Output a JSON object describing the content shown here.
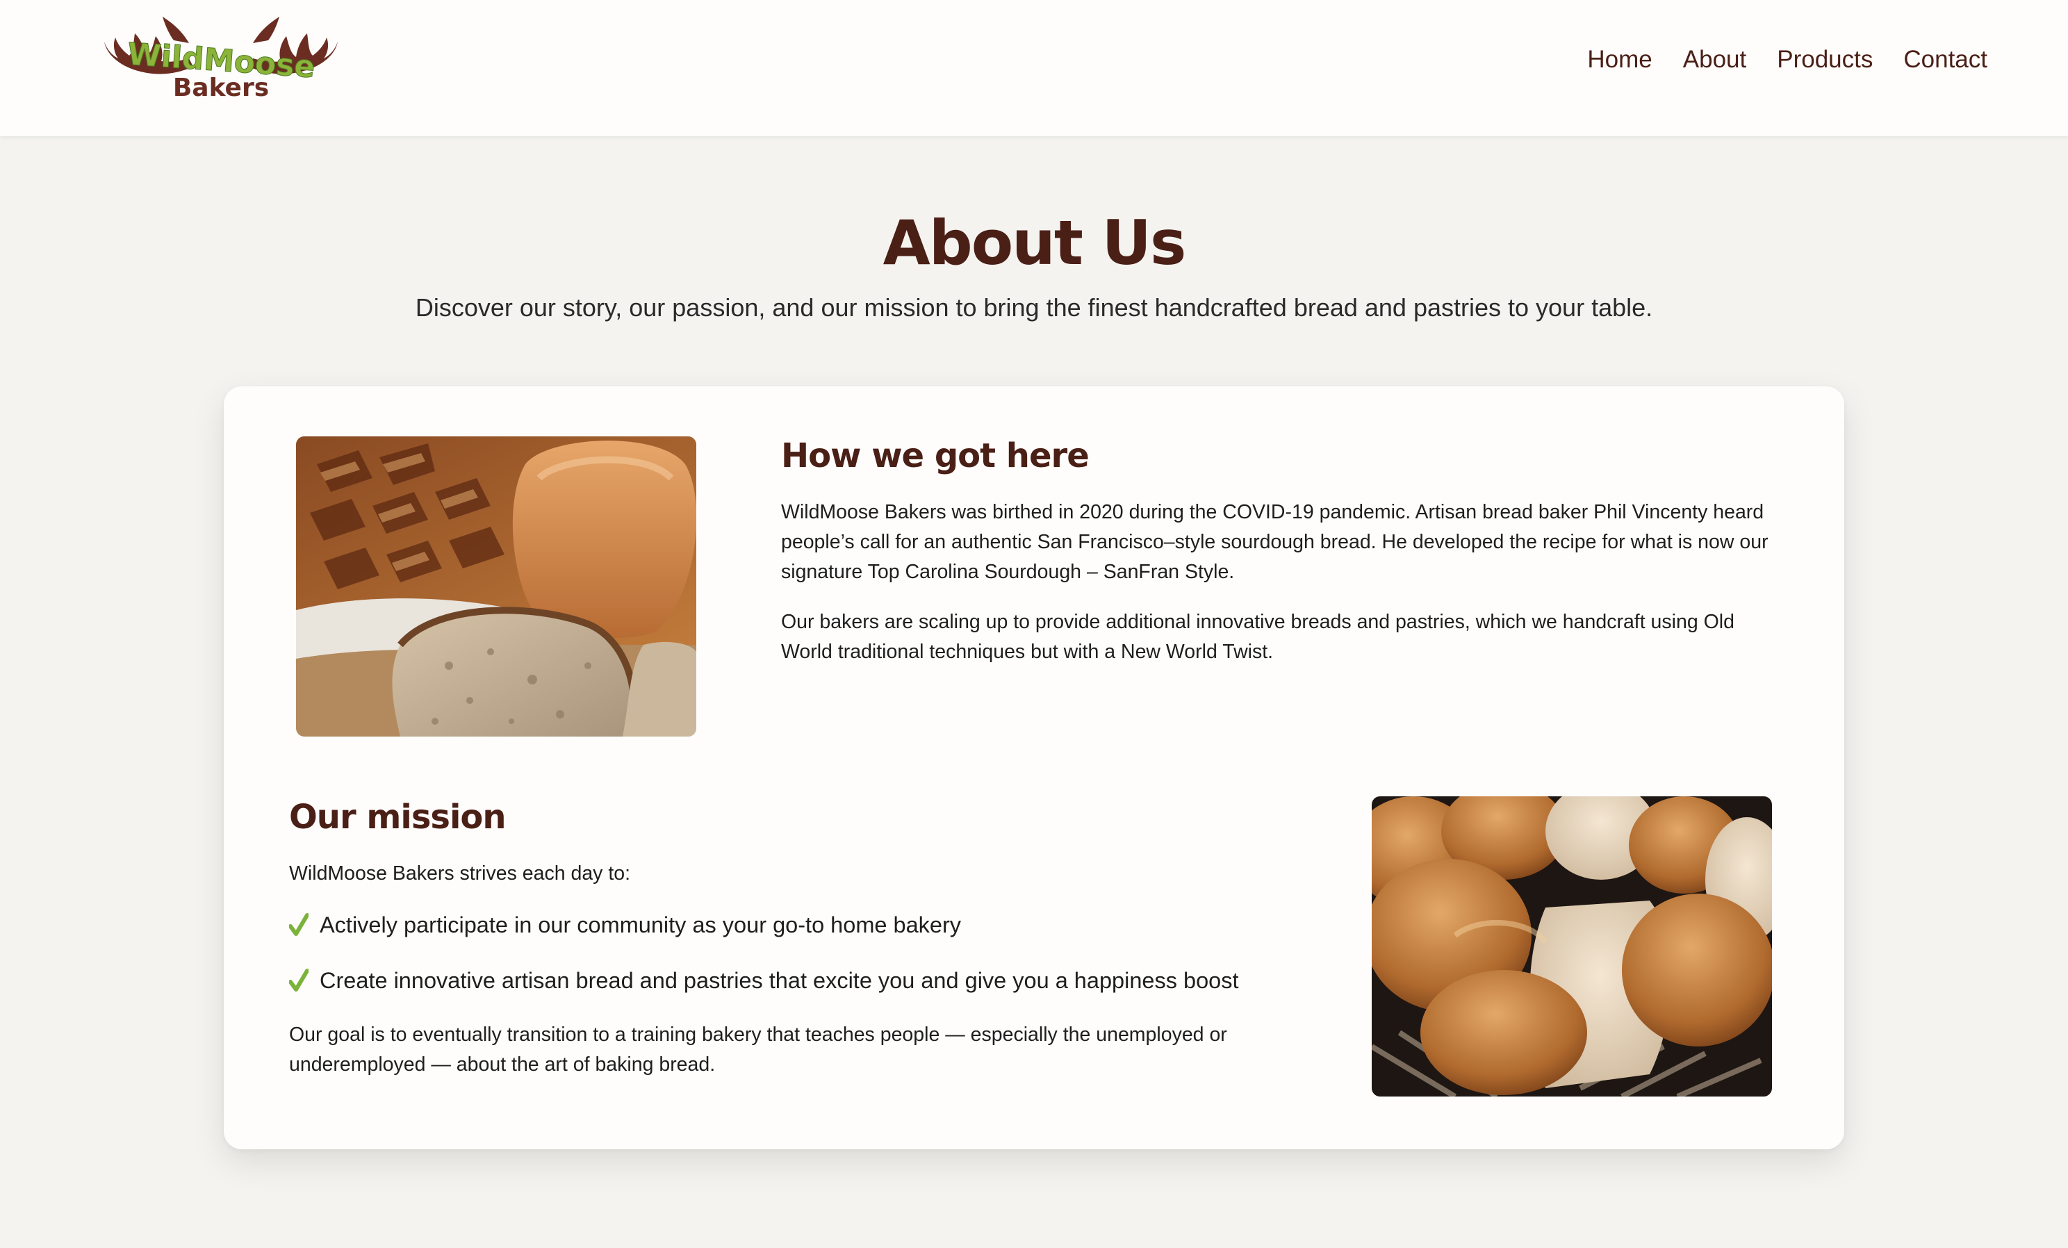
{
  "brand": {
    "logo_word_1": "WildMoose",
    "logo_word_2": "Bakers",
    "colors": {
      "brown": "#4a1f16",
      "green": "#8cb33a",
      "background": "#f4f3ef"
    }
  },
  "nav": {
    "items": [
      {
        "label": "Home"
      },
      {
        "label": "About"
      },
      {
        "label": "Products"
      },
      {
        "label": "Contact"
      }
    ]
  },
  "hero": {
    "title": "About Us",
    "subtitle": "Discover our story, our passion, and our mission to bring the finest handcrafted bread and pastries to your table."
  },
  "history": {
    "title": "How we got here",
    "paragraphs": [
      "WildMoose Bakers was birthed in 2020 during the COVID-19 pandemic. Artisan bread baker Phil Vincenty heard people’s call for an authentic San Francisco–style sourdough bread. He developed the recipe for what is now our signature Top Carolina Sourdough – SanFran Style.",
      "Our bakers are scaling up to provide additional innovative breads and pastries, which we handcraft using Old World traditional techniques but with a New World Twist."
    ]
  },
  "mission": {
    "title": "Our mission",
    "intro": "WildMoose Bakers strives each day to:",
    "goals": [
      "Actively participate in our community as your go-to home bakery",
      "Create innovative artisan bread and pastries that excite you and give you a happiness boost"
    ],
    "closing": "Our goal is to eventually transition to a training bakery that teaches people — especially the unemployed or underemployed — about the art of baking bread."
  },
  "icons": {
    "check": "check-icon"
  }
}
